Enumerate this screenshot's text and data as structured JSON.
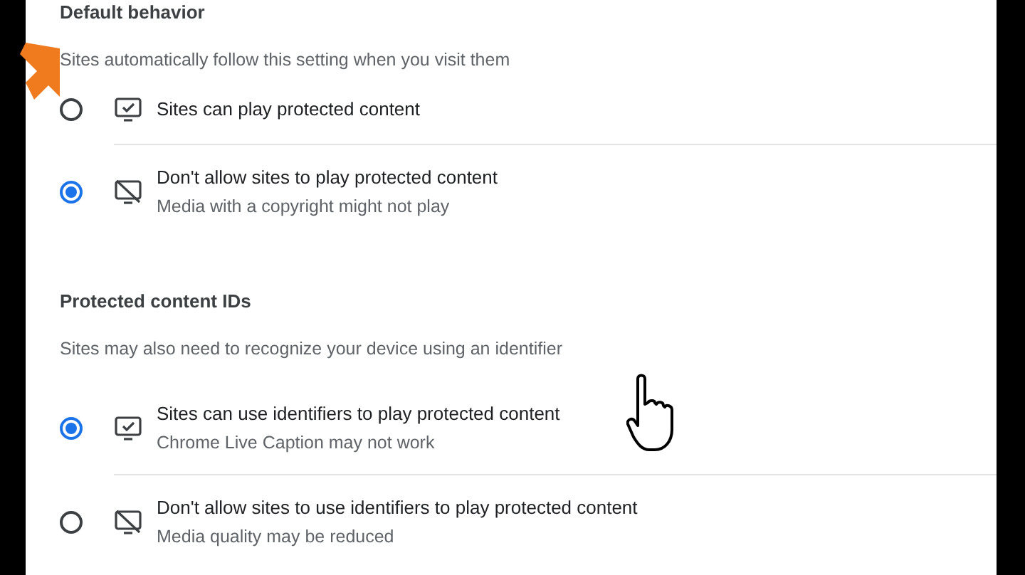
{
  "sections": [
    {
      "heading": "Default behavior",
      "description": "Sites automatically follow this setting when you visit them",
      "options": [
        {
          "kind": "allow",
          "title": "Sites can play protected content",
          "selected": false
        },
        {
          "kind": "block",
          "title": "Don't allow sites to play protected content",
          "subtitle": "Media with a copyright might not play",
          "selected": true
        }
      ]
    },
    {
      "heading": "Protected content IDs",
      "description": "Sites may also need to recognize your device using an identifier",
      "options": [
        {
          "kind": "allow",
          "title": "Sites can use identifiers to play protected content",
          "subtitle": "Chrome Live Caption may not work",
          "selected": true
        },
        {
          "kind": "block",
          "title": "Don't allow sites to use identifiers to play protected content",
          "subtitle": "Media quality may be reduced",
          "selected": false
        }
      ]
    }
  ]
}
